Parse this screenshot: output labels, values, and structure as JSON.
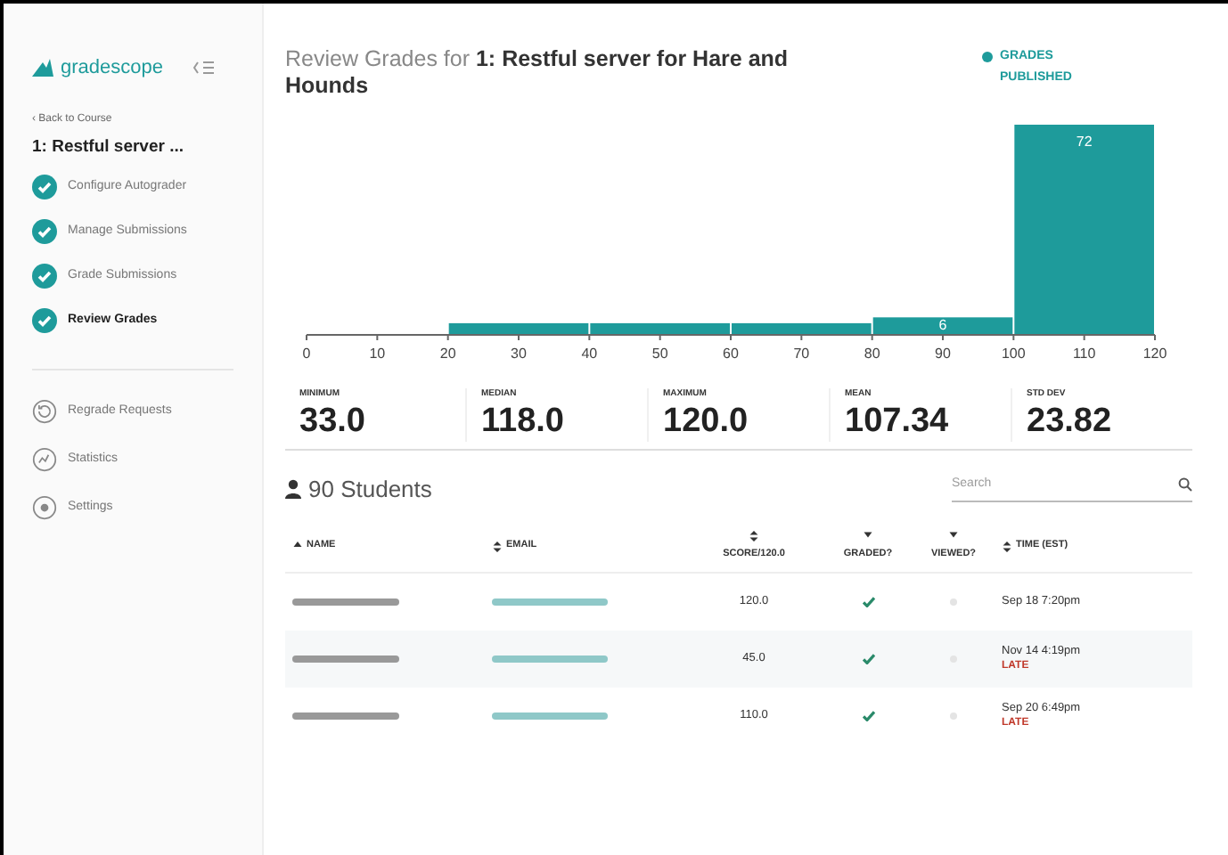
{
  "sidebar": {
    "logo": "gradescope",
    "back_link": "‹ Back to Course",
    "assignment": "1: Restful server ...",
    "steps": [
      {
        "label": "Configure Autograder",
        "done": true,
        "selected": false
      },
      {
        "label": "Manage Submissions",
        "done": true,
        "selected": false
      },
      {
        "label": "Grade Submissions",
        "done": true,
        "selected": false
      },
      {
        "label": "Review Grades",
        "done": true,
        "selected": true
      }
    ],
    "links": [
      {
        "kind": "regrade",
        "label": "Regrade Requests"
      },
      {
        "kind": "statistics",
        "label": "Statistics"
      },
      {
        "kind": "settings",
        "label": "Settings"
      }
    ]
  },
  "header": {
    "prefix": "Review Grades for ",
    "title": "1: Restful server for Hare and Hounds",
    "status": "GRADES PUBLISHED"
  },
  "histogram": {
    "chart_data": {
      "type": "bar",
      "x": [
        10,
        30,
        50,
        70,
        90,
        110
      ],
      "values": [
        0,
        4,
        4,
        4,
        6,
        72
      ],
      "xlim": [
        0,
        120
      ],
      "xticks": [
        0,
        10,
        20,
        30,
        40,
        50,
        60,
        70,
        80,
        90,
        100,
        110,
        120
      ],
      "value_labels": [
        null,
        null,
        null,
        null,
        "6",
        "72"
      ]
    }
  },
  "stats": [
    {
      "label": "MINIMUM",
      "value": "33.0"
    },
    {
      "label": "MEDIAN",
      "value": "118.0"
    },
    {
      "label": "MAXIMUM",
      "value": "120.0"
    },
    {
      "label": "MEAN",
      "value": "107.34"
    },
    {
      "label": "STD DEV",
      "value": "23.82"
    }
  ],
  "students": {
    "count": "90 Students",
    "search": {
      "placeholder": "Search"
    }
  },
  "table": {
    "columns": [
      {
        "label": "NAME",
        "kind": "sort",
        "sorted": true
      },
      {
        "label": "EMAIL",
        "kind": "sort",
        "sorted": false
      },
      {
        "label": "SCORE/120.0",
        "kind": "sort",
        "sorted": false
      },
      {
        "label": "GRADED?",
        "kind": "filter"
      },
      {
        "label": "VIEWED?",
        "kind": "filter"
      },
      {
        "label": "TIME (EST)",
        "kind": "sort",
        "sorted": false
      }
    ],
    "rows": [
      {
        "score": "120.0",
        "graded": true,
        "viewed": false,
        "time": "Sep 18 7:20pm"
      },
      {
        "score": "45.0",
        "graded": true,
        "viewed": false,
        "time": "Nov 14 4:19pm",
        "late": "LATE"
      },
      {
        "score": "110.0",
        "graded": true,
        "viewed": false,
        "time": "Sep 20 6:49pm",
        "late": "LATE"
      }
    ]
  }
}
